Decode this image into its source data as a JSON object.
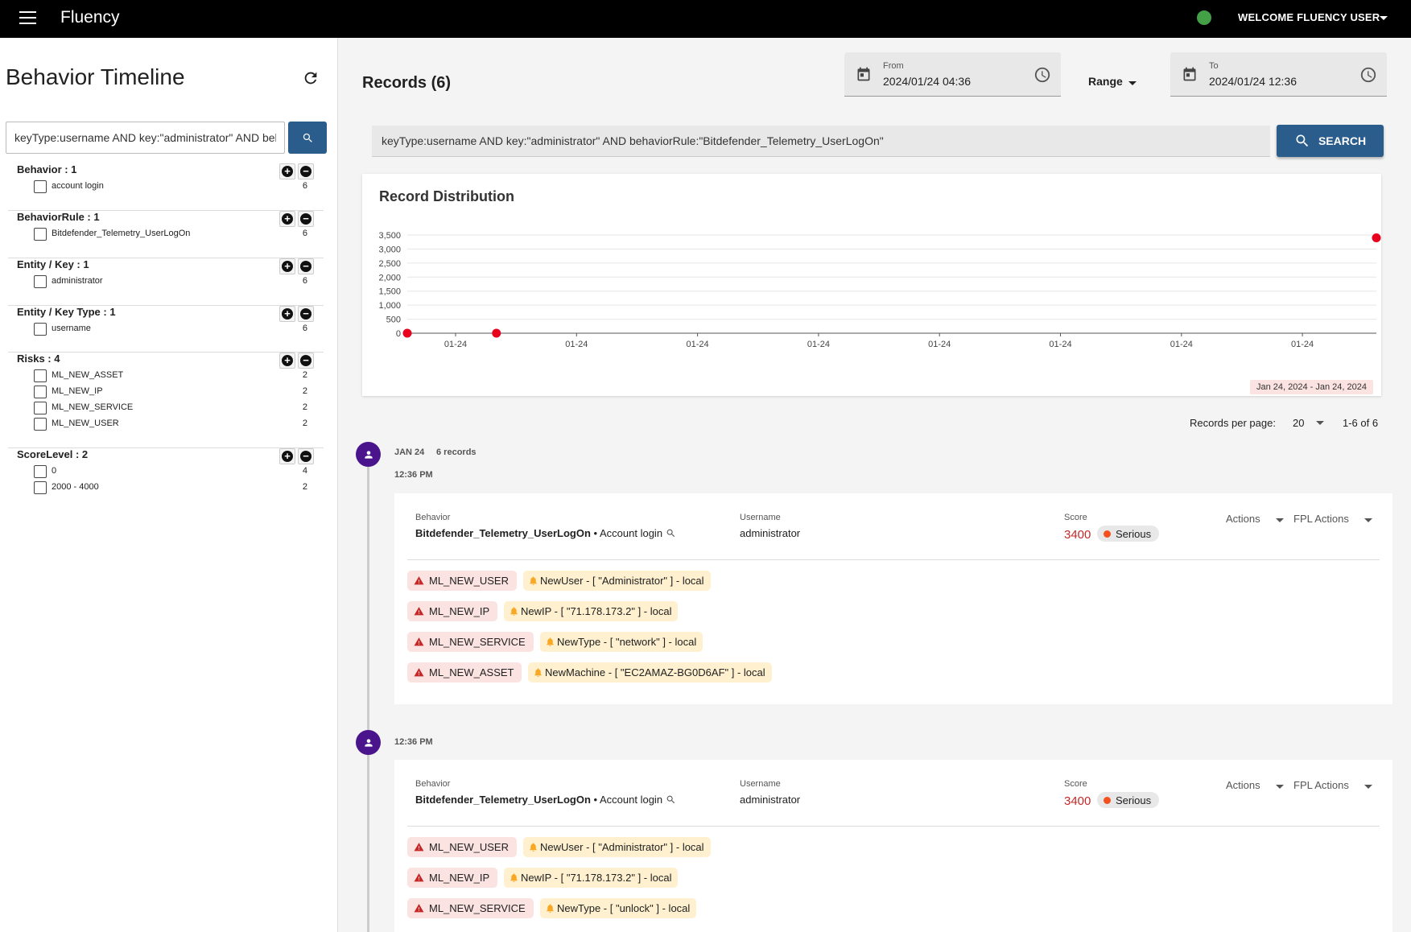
{
  "app": {
    "title": "Fluency",
    "welcome": "WELCOME FLUENCY USER"
  },
  "sidebar": {
    "title": "Behavior Timeline",
    "search_value": "keyType:username AND key:\"administrator\" AND behaviorRule:\"Bitdefender_Telemetry_UserLogOn\"",
    "facets": [
      {
        "title": "Behavior : 1",
        "items": [
          {
            "label": "account login",
            "count": "6"
          }
        ]
      },
      {
        "title": "BehaviorRule : 1",
        "items": [
          {
            "label": "Bitdefender_Telemetry_UserLogOn",
            "count": "6"
          }
        ]
      },
      {
        "title": "Entity / Key : 1",
        "items": [
          {
            "label": "administrator",
            "count": "6"
          }
        ]
      },
      {
        "title": "Entity / Key Type : 1",
        "items": [
          {
            "label": "username",
            "count": "6"
          }
        ]
      },
      {
        "title": "Risks : 4",
        "items": [
          {
            "label": "ML_NEW_ASSET",
            "count": "2"
          },
          {
            "label": "ML_NEW_IP",
            "count": "2"
          },
          {
            "label": "ML_NEW_SERVICE",
            "count": "2"
          },
          {
            "label": "ML_NEW_USER",
            "count": "2"
          }
        ]
      },
      {
        "title": "ScoreLevel : 2",
        "items": [
          {
            "label": "0",
            "count": "4"
          },
          {
            "label": "2000 - 4000",
            "count": "2"
          }
        ]
      }
    ]
  },
  "main": {
    "records_title": "Records (6)",
    "from": {
      "label": "From",
      "value": "2024/01/24 04:36"
    },
    "to": {
      "label": "To",
      "value": "2024/01/24 12:36"
    },
    "range_label": "Range",
    "search_value": "keyType:username AND key:\"administrator\" AND behaviorRule:\"Bitdefender_Telemetry_UserLogOn\"",
    "search_button": "SEARCH",
    "records_per_page_label": "Records per page:",
    "records_per_page": "20",
    "page_range": "1-6 of 6",
    "group": {
      "date": "JAN 24",
      "count": "6 records"
    }
  },
  "chart_data": {
    "type": "scatter",
    "title": "Record Distribution",
    "yticks": [
      "0",
      "500",
      "1,000",
      "1,500",
      "2,000",
      "2,500",
      "3,000",
      "3,500"
    ],
    "ylim": [
      0,
      3500
    ],
    "xticks": [
      "01-24",
      "01-24",
      "01-24",
      "01-24",
      "01-24",
      "01-24",
      "01-24",
      "01-24"
    ],
    "points": [
      {
        "x": 0,
        "y": 0
      },
      {
        "x": 0.092,
        "y": 0
      },
      {
        "x": 1.0,
        "y": 3400
      }
    ],
    "date_range": "Jan 24, 2024 - Jan 24, 2024",
    "grid": true,
    "point_color": "#e8001c"
  },
  "records": [
    {
      "time": "12:36 PM",
      "behavior_label": "Behavior",
      "behavior_rule": "Bitdefender_Telemetry_UserLogOn",
      "behavior_name": " • Account login",
      "username_label": "Username",
      "username": "administrator",
      "score_label": "Score",
      "score": "3400",
      "level": "Serious",
      "actions": "Actions",
      "fpl_actions": "FPL Actions",
      "risks": [
        {
          "risk": "ML_NEW_USER",
          "event": "NewUser - [ \"Administrator\" ] - local"
        },
        {
          "risk": "ML_NEW_IP",
          "event": "NewIP - [ \"71.178.173.2\" ] - local"
        },
        {
          "risk": "ML_NEW_SERVICE",
          "event": "NewType - [ \"network\" ] - local"
        },
        {
          "risk": "ML_NEW_ASSET",
          "event": "NewMachine - [ \"EC2AMAZ-BG0D6AF\" ] - local"
        }
      ]
    },
    {
      "time": "12:36 PM",
      "behavior_label": "Behavior",
      "behavior_rule": "Bitdefender_Telemetry_UserLogOn",
      "behavior_name": " • Account login",
      "username_label": "Username",
      "username": "administrator",
      "score_label": "Score",
      "score": "3400",
      "level": "Serious",
      "actions": "Actions",
      "fpl_actions": "FPL Actions",
      "risks": [
        {
          "risk": "ML_NEW_USER",
          "event": "NewUser - [ \"Administrator\" ] - local"
        },
        {
          "risk": "ML_NEW_IP",
          "event": "NewIP - [ \"71.178.173.2\" ] - local"
        },
        {
          "risk": "ML_NEW_SERVICE",
          "event": "NewType - [ \"unlock\" ] - local"
        }
      ]
    }
  ],
  "colors": {
    "accent": "#2b5d8c",
    "avatar": "#4a148c",
    "risk_bg": "#fbe3e1",
    "event_bg": "#fff1cf",
    "score": "#c62828",
    "status_ok": "#43a047"
  }
}
